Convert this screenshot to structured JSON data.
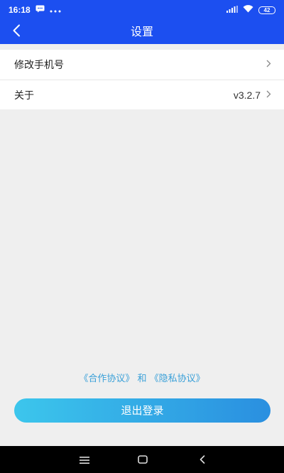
{
  "status_bar": {
    "time": "16:18",
    "battery": "42",
    "icons": [
      "message-icon",
      "more-dots-icon",
      "signal-icon",
      "wifi-icon",
      "battery-icon"
    ]
  },
  "header": {
    "title": "设置",
    "back_icon": "back-arrow-icon"
  },
  "settings": {
    "items": [
      {
        "label": "修改手机号",
        "value": ""
      },
      {
        "label": "关于",
        "value": "v3.2.7"
      }
    ]
  },
  "agreements": {
    "cooperation": "《合作协议》",
    "conjunction": "和",
    "privacy": "《隐私协议》",
    "color": "#3aa0d8"
  },
  "logout": {
    "label": "退出登录"
  },
  "nav_bar": {
    "icons": [
      "menu-icon",
      "home-icon",
      "back-icon"
    ]
  },
  "colors": {
    "primary": "#1c4ff0",
    "background": "#efefef",
    "button_start": "#3cc6ec",
    "button_end": "#2a8fe0"
  }
}
